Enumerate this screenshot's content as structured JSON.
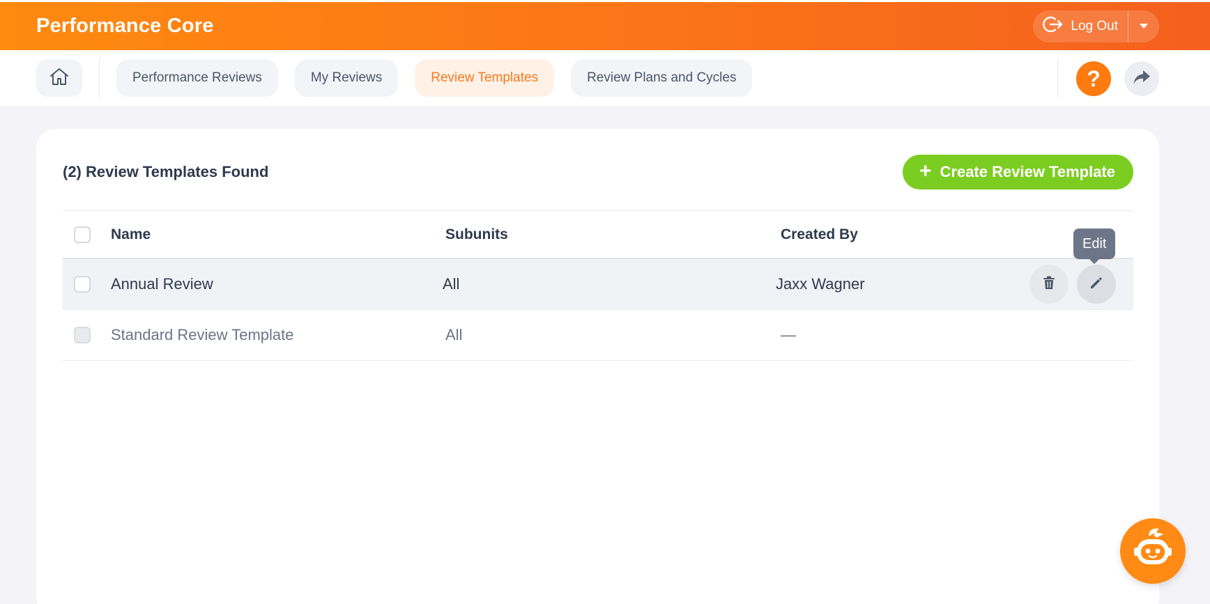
{
  "app": {
    "title": "Performance Core"
  },
  "header": {
    "logout_label": "Log Out",
    "logout_icon": "logout-icon",
    "dropdown_icon": "caret-down-icon"
  },
  "nav": {
    "home_icon": "home-icon",
    "tabs": [
      {
        "label": "Performance Reviews",
        "active": false
      },
      {
        "label": "My Reviews",
        "active": false
      },
      {
        "label": "Review Templates",
        "active": true
      },
      {
        "label": "Review Plans and Cycles",
        "active": false
      }
    ],
    "help_label": "?",
    "share_icon": "share-arrow-icon"
  },
  "main": {
    "found_label": "(2) Review Templates Found",
    "create_label": "Create Review Template",
    "columns": [
      "Name",
      "Subunits",
      "Created By"
    ],
    "rows": [
      {
        "name": "Annual Review",
        "subunits": "All",
        "created_by": "Jaxx Wagner"
      },
      {
        "name": "Standard Review Template",
        "subunits": "All",
        "created_by": "—"
      }
    ],
    "tooltip": "Edit"
  },
  "colors": {
    "brand_orange": "#ff7a0f",
    "create_green": "#7ccd22",
    "active_tab_text": "#f47a20"
  }
}
